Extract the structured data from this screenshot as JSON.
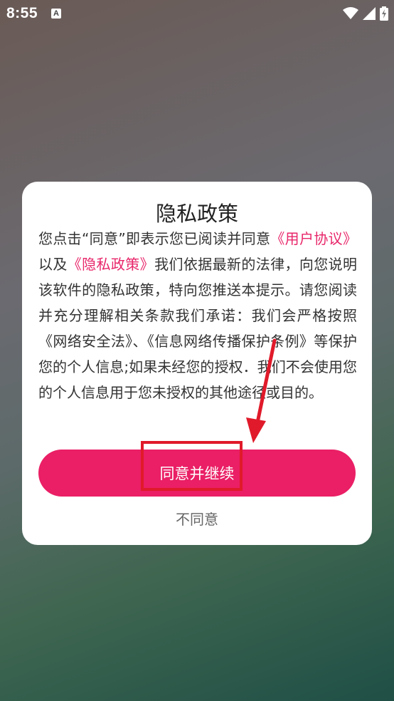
{
  "status_bar": {
    "time": "8:55",
    "notification_icon": "text-a-icon",
    "wifi_icon": "wifi-icon",
    "signal_icon": "signal-icon",
    "battery_icon": "battery-charging-icon"
  },
  "dialog": {
    "title": "隐私政策",
    "body": {
      "intro": "您点击“同意”即表示您已阅读并同意",
      "user_agreement_link": "《用户协议》",
      "and": "以及",
      "privacy_policy_link": "《隐私政策》",
      "rest": "我们依据最新的法律，向您说明该软件的隐私政策，特向您推送本提示。请您阅读并充分理解相关条款我们承诺：我们会严格按照《网络安全法》、《信息网络传播保护条例》等保护您的个人信息;如果未经您的授权．我们不会使用您的个人信息用于您未授权的其他途径或目的。"
    },
    "agree_button": "同意并继续",
    "decline_button": "不同意"
  },
  "colors": {
    "accent": "#ea1f65",
    "link": "#e8266a",
    "annotation": "#e01a2a"
  }
}
